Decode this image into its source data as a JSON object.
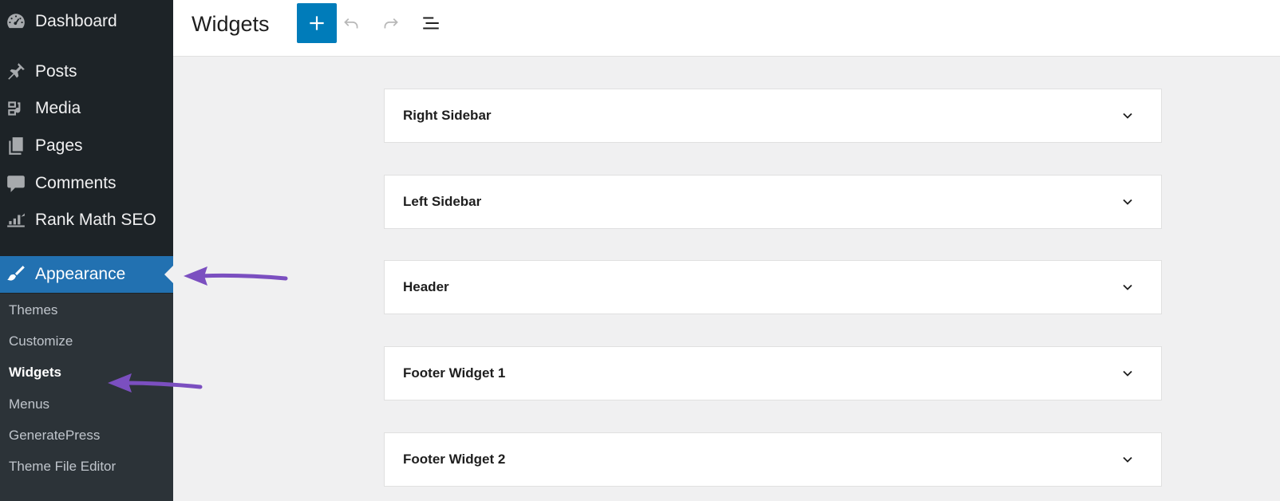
{
  "sidebar": {
    "items": [
      {
        "label": "Dashboard",
        "icon": "dashboard-icon"
      },
      {
        "label": "Posts",
        "icon": "pushpin-icon"
      },
      {
        "label": "Media",
        "icon": "media-icon"
      },
      {
        "label": "Pages",
        "icon": "pages-icon"
      },
      {
        "label": "Comments",
        "icon": "comment-icon"
      },
      {
        "label": "Rank Math SEO",
        "icon": "rank-math-icon"
      },
      {
        "label": "Appearance",
        "icon": "paintbrush-icon",
        "active": true
      }
    ],
    "submenu": [
      {
        "label": "Themes"
      },
      {
        "label": "Customize"
      },
      {
        "label": "Widgets",
        "current": true
      },
      {
        "label": "Menus"
      },
      {
        "label": "GeneratePress"
      },
      {
        "label": "Theme File Editor"
      }
    ]
  },
  "header": {
    "title": "Widgets",
    "buttons": [
      "plus-icon",
      "undo-icon",
      "redo-icon",
      "list-view-icon"
    ]
  },
  "widget_areas": [
    {
      "title": "Right Sidebar"
    },
    {
      "title": "Left Sidebar"
    },
    {
      "title": "Header"
    },
    {
      "title": "Footer Widget 1"
    },
    {
      "title": "Footer Widget 2"
    }
  ],
  "colors": {
    "sidebar_bg": "#1d2327",
    "submenu_bg": "#2c3338",
    "accent": "#2271b1",
    "add_button": "#007cba",
    "arrow": "#7b4fc0"
  }
}
